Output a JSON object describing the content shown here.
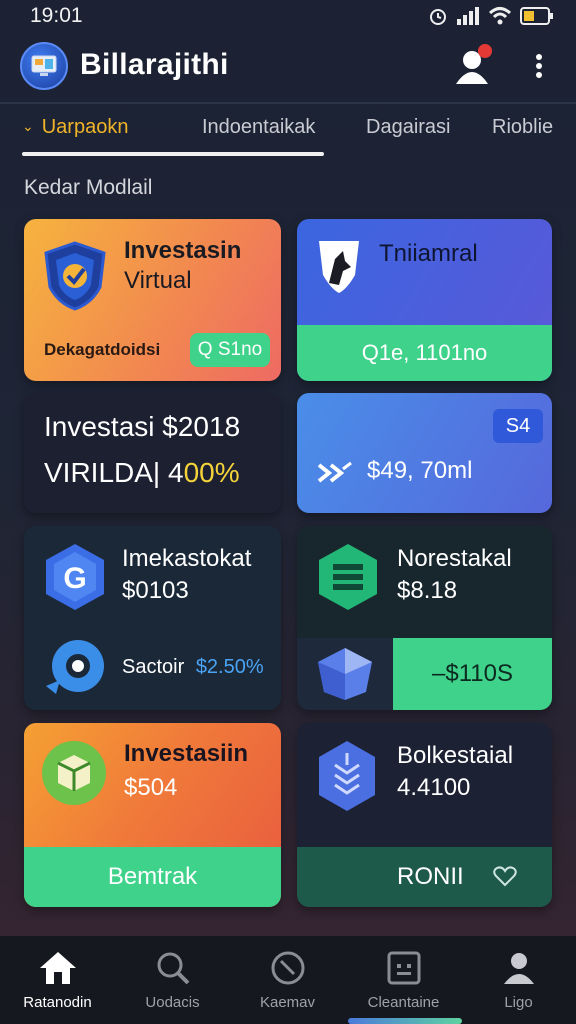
{
  "status_bar": {
    "time": "19:01"
  },
  "header": {
    "title": "Billarajithi"
  },
  "tabs": [
    {
      "label": "Uarpaokn",
      "active": true
    },
    {
      "label": "Indoentaikak",
      "active": false
    },
    {
      "label": "Dagairasi",
      "active": false
    },
    {
      "label": "Rioblie",
      "active": false
    }
  ],
  "section_title": "Kedar Modlail",
  "cards": {
    "c1": {
      "title_line1": "Investasin",
      "title_line2": "Virtual",
      "caption": "Dekagatdoidsi",
      "pill": "Q S1no"
    },
    "c2": {
      "title": "Tniiamral",
      "pill": "Q1e, 1101no"
    },
    "c3": {
      "line1": "Investasi $2018",
      "line2_prefix": "VIRILDA| 4",
      "line2_highlight": "00%"
    },
    "c4": {
      "badge": "S4",
      "amount": "$49, 70ml"
    },
    "c5": {
      "title": "Imekastokat",
      "amount": "$0103",
      "sub_label": "Sactoir",
      "sub_value": "$2.50%"
    },
    "c6": {
      "title": "Norestakal",
      "amount": "$8.18",
      "pill": "–$110S"
    },
    "c7": {
      "title": "Investasiin",
      "amount": "$504",
      "button": "Bemtrak"
    },
    "c8": {
      "title": "Bolkestaial",
      "amount": "4.4100",
      "button": "RONII"
    }
  },
  "bottom_nav": [
    {
      "label": "Ratanodin",
      "icon": "home-icon",
      "active": true
    },
    {
      "label": "Uodacis",
      "icon": "search-icon",
      "active": false
    },
    {
      "label": "Kaemav",
      "icon": "compass-icon",
      "active": false
    },
    {
      "label": "Cleantaine",
      "icon": "grid-icon",
      "active": false
    },
    {
      "label": "Ligo",
      "icon": "user-icon",
      "active": false
    }
  ],
  "colors": {
    "accent": "#f0b429",
    "green": "#3ed28a",
    "blue": "#3b66e0"
  }
}
